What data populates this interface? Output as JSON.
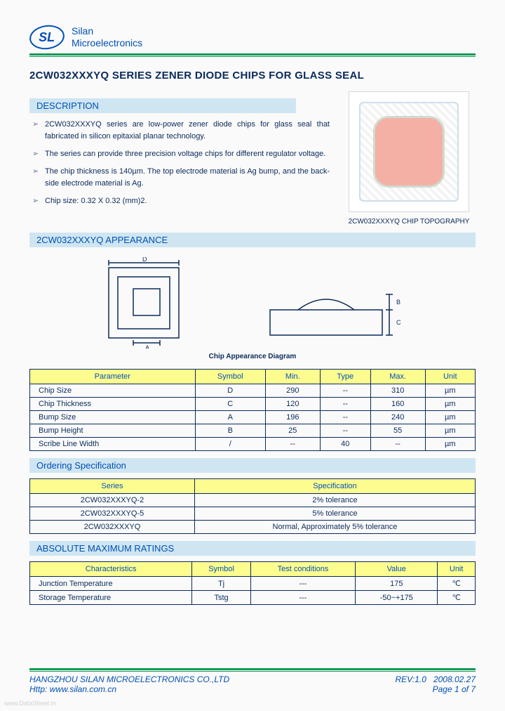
{
  "brand": {
    "l1": "Silan",
    "l2": "Microelectronics",
    "logo": "SL"
  },
  "title": "2CW032XXXYQ SERIES ZENER DIODE CHIPS FOR GLASS SEAL",
  "sections": {
    "desc": "DESCRIPTION",
    "app": "2CW032XXXYQ APPEARANCE",
    "ord": "Ordering Specification",
    "amr": "ABSOLUTE MAXIMUM RATINGS"
  },
  "bullets": [
    "2CW032XXXYQ series are low-power zener diode chips for glass seal that fabricated in silicon epitaxial planar technology.",
    "The series can provide three precision voltage chips for different regulator voltage.",
    "The chip thickness is 140µm. The top electrode material is Ag bump, and the back-side electrode material is Ag.",
    "Chip size: 0.32 X 0.32 (mm)2."
  ],
  "chipCaption": "2CW032XXXYQ CHIP TOPOGRAPHY",
  "chipDiagram": "Chip Appearance Diagram",
  "chart_data": [
    {
      "type": "table",
      "title": "Chip Parameters",
      "columns": [
        "Parameter",
        "Symbol",
        "Min.",
        "Type",
        "Max.",
        "Unit"
      ],
      "rows": [
        [
          "Chip Size",
          "D",
          "290",
          "--",
          "310",
          "µm"
        ],
        [
          "Chip Thickness",
          "C",
          "120",
          "--",
          "160",
          "µm"
        ],
        [
          "Bump Size",
          "A",
          "196",
          "--",
          "240",
          "µm"
        ],
        [
          "Bump Height",
          "B",
          "25",
          "--",
          "55",
          "µm"
        ],
        [
          "Scribe Line Width",
          "/",
          "--",
          "40",
          "--",
          "µm"
        ]
      ]
    },
    {
      "type": "table",
      "title": "Ordering Specification",
      "columns": [
        "Series",
        "Specification"
      ],
      "rows": [
        [
          "2CW032XXXYQ-2",
          "2% tolerance"
        ],
        [
          "2CW032XXXYQ-5",
          "5% tolerance"
        ],
        [
          "2CW032XXXYQ",
          "Normal, Approximately 5% tolerance"
        ]
      ]
    },
    {
      "type": "table",
      "title": "Absolute Maximum Ratings",
      "columns": [
        "Characteristics",
        "Symbol",
        "Test conditions",
        "Value",
        "Unit"
      ],
      "rows": [
        [
          "Junction Temperature",
          "Tj",
          "---",
          "175",
          "℃"
        ],
        [
          "Storage Temperature",
          "Tstg",
          "---",
          "-50~+175",
          "℃"
        ]
      ]
    }
  ],
  "footer": {
    "company": "HANGZHOU SILAN MICROELECTRONICS CO.,LTD",
    "rev": "REV:1.0",
    "date": "2008.02.27",
    "url": "Http: www.silan.com.cn",
    "page": "Page 1 of 7"
  },
  "watermark": "www.DataSheet.in"
}
